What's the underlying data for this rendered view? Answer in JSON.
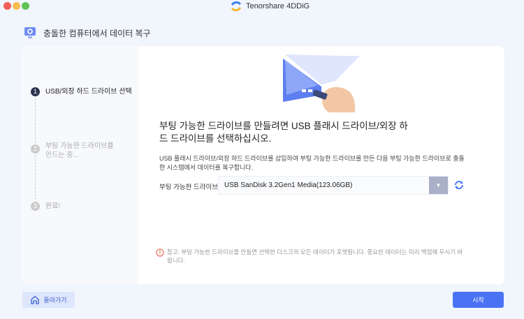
{
  "window": {
    "app_title": "Tenorshare 4DDiG"
  },
  "header": {
    "title": "충돌한 컴퓨터에서 데이터 복구"
  },
  "steps": [
    {
      "num": "1",
      "label": "USB/외장 하드 드라이브 선택"
    },
    {
      "num": "2",
      "label": "부팅 가능한 드라이브를 만드는 중..."
    },
    {
      "num": "3",
      "label": "완료!"
    }
  ],
  "main": {
    "heading": "부팅 가능한 드라이브를 만들려면 USB 플래시 드라이브/외장 하드 드라이브를 선택하십시오.",
    "description": "USB 플래시 드라이브/외장 하드 드라이브를 삽입하여 부팅 가능한 드라이브를 만든 다음 부팅 가능한 드라이브로 충돌한 시스템에서 데이터를 복구합니다.",
    "drive_label": "부팅 가능한 드라이브:",
    "drive_selected": "USB SanDisk 3.2Gen1 Media(123.06GB)",
    "note": "참고: 부팅 가능한 드라이브를 만들면 선택한 디스크의 모든 데이터가 포맷됩니다. 중요한 데이터는 미리 백업해 두시기 바랍니다."
  },
  "footer": {
    "back_label": "돌아가기",
    "start_label": "시작"
  }
}
